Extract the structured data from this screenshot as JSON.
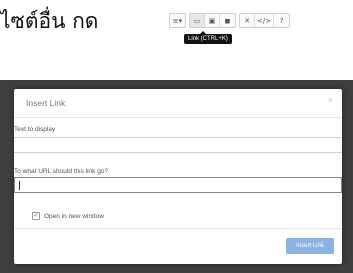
{
  "instruction_text": "ไซต์อื่น กด",
  "toolbar": {
    "buttons": [
      {
        "icon": "list-style-icon",
        "glyph": "≡▾"
      },
      {
        "icon": "link-icon",
        "glyph": "▭"
      },
      {
        "icon": "picture-icon",
        "glyph": "▣"
      },
      {
        "icon": "video-icon",
        "glyph": "◼"
      },
      {
        "icon": "fullscreen-icon",
        "glyph": "✕"
      },
      {
        "icon": "code-view-icon",
        "glyph": "</>"
      },
      {
        "icon": "help-icon",
        "glyph": "?"
      }
    ],
    "tooltip": "Link (CTRL+K)"
  },
  "modal": {
    "title": "Insert Link",
    "close_glyph": "×",
    "text_label": "Text to display",
    "text_value": "",
    "url_label": "To what URL should this link go?",
    "url_value": "",
    "new_window_label": "Open in new window",
    "new_window_checked": true,
    "check_glyph": "✓",
    "submit_label": "Insert Link"
  },
  "colors": {
    "backdrop": "#3e3e3e",
    "primary_button": "#8bb3e6"
  }
}
